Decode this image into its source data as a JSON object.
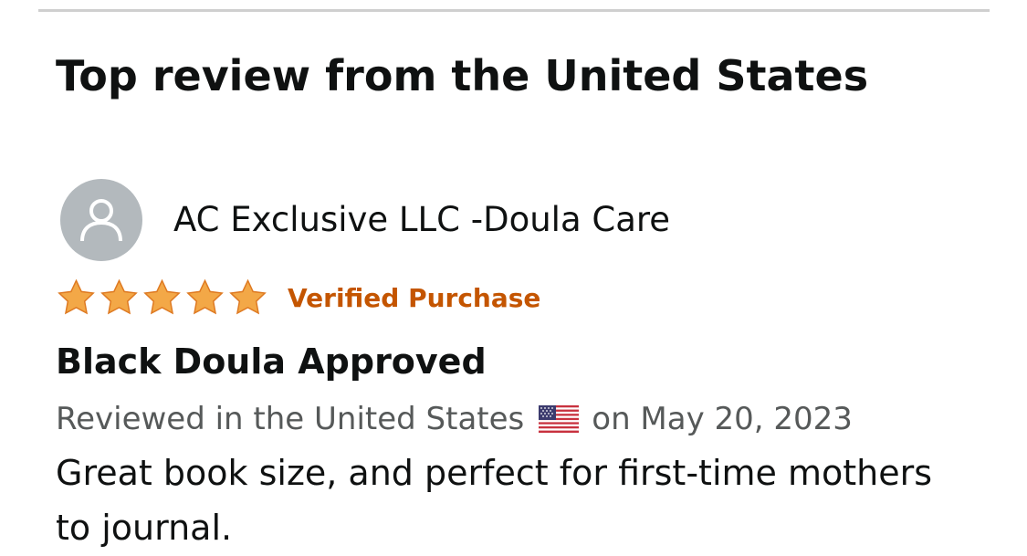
{
  "section": {
    "title": "Top review from the United States"
  },
  "review": {
    "reviewer_name": "AC Exclusive LLC -Doula Care",
    "rating": 5,
    "rating_max": 5,
    "verified_label": "Verified Purchase",
    "title": "Black Doula Approved",
    "meta_prefix": "Reviewed in the United States",
    "meta_suffix": "on May 20, 2023",
    "body": "Great book size, and perfect for first-time mothers to journal."
  },
  "colors": {
    "star": "#f3a847",
    "verified": "#c45500",
    "avatar_bg": "#b3b9bd",
    "meta_text": "#565959"
  },
  "icons": {
    "avatar": "person-silhouette-icon",
    "star": "star-icon",
    "flag": "us-flag-icon"
  }
}
